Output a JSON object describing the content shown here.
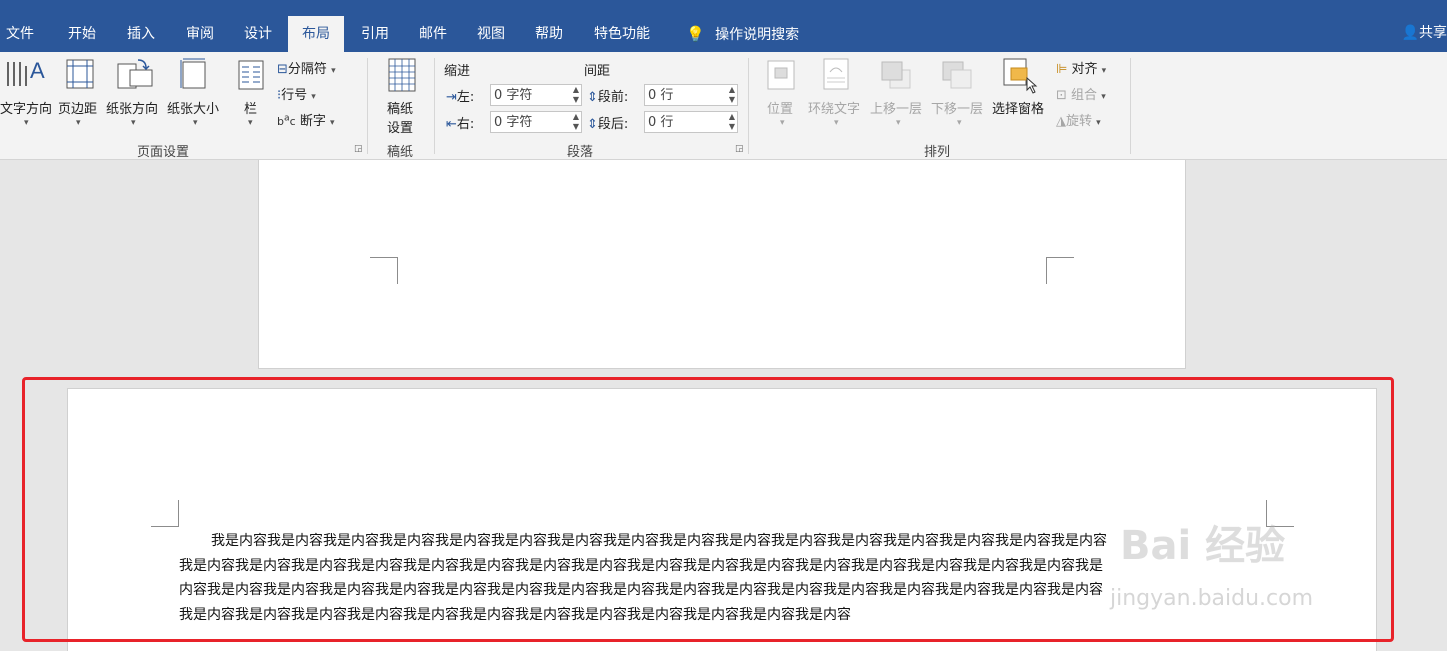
{
  "tabs": [
    "文件",
    "开始",
    "插入",
    "审阅",
    "设计",
    "布局",
    "引用",
    "邮件",
    "视图",
    "帮助",
    "特色功能"
  ],
  "active_tab": "布局",
  "tell_me": "操作说明搜索",
  "share": "共享",
  "ribbon": {
    "page_setup": {
      "text_direction": "文字方向",
      "margins": "页边距",
      "orientation": "纸张方向",
      "size": "纸张大小",
      "columns": "栏",
      "breaks": "分隔符",
      "line_numbers": "行号",
      "hyphenation": "断字",
      "label": "页面设置"
    },
    "manuscript": {
      "button_line1": "稿纸",
      "button_line2": "设置",
      "label": "稿纸"
    },
    "paragraph": {
      "indent_title": "缩进",
      "spacing_title": "间距",
      "left_label": "左:",
      "right_label": "右:",
      "before_label": "段前:",
      "after_label": "段后:",
      "left_value": "0 字符",
      "right_value": "0 字符",
      "before_value": "0 行",
      "after_value": "0 行",
      "label": "段落"
    },
    "arrange": {
      "position": "位置",
      "wrap_text": "环绕文字",
      "bring_forward": "上移一层",
      "send_backward": "下移一层",
      "selection_pane": "选择窗格",
      "align": "对齐",
      "group": "组合",
      "rotate": "旋转",
      "label": "排列"
    }
  },
  "document": {
    "lines": [
      "我是内容我是内容我是内容我是内容我是内容我是内容我是内容我是内容我是内容我是内容我是内容我是内容我是内容我是内容我是内容我是内容",
      "我是内容我是内容我是内容我是内容我是内容我是内容我是内容我是内容我是内容我是内容我是内容我是内容我是内容我是内容我是内容我是内容我是",
      "内容我是内容我是内容我是内容我是内容我是内容我是内容我是内容我是内容我是内容我是内容我是内容我是内容我是内容我是内容我是内容我是内容",
      "我是内容我是内容我是内容我是内容我是内容我是内容我是内容我是内容我是内容我是内容我是内容我是内容"
    ]
  },
  "watermark": {
    "line1": "Bai 经验",
    "line2": "jingyan.baidu.com"
  },
  "colors": {
    "ribbon_blue": "#2b579a",
    "highlight_red": "#e8232a"
  }
}
